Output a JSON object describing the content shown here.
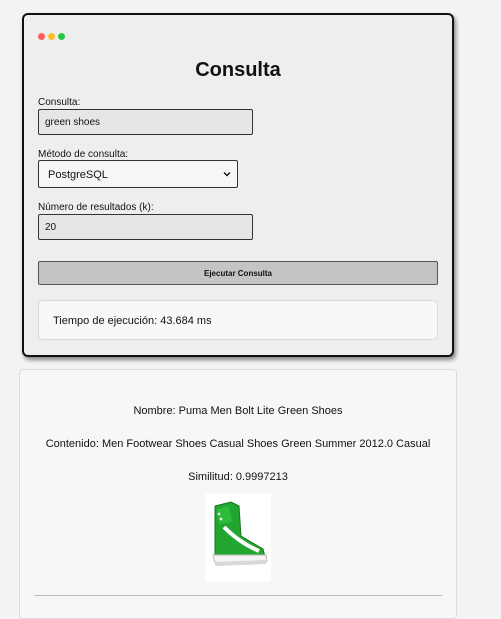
{
  "window": {
    "controls": [
      "close-dot",
      "minimize-dot",
      "maximize-dot"
    ],
    "colors": {
      "red": "#ff5f57",
      "yellow": "#ffbd2e",
      "green": "#28c940"
    }
  },
  "form": {
    "title": "Consulta",
    "query_label": "Consulta:",
    "query_value": "green shoes",
    "method_label": "Método de consulta:",
    "method_value": "PostgreSQL",
    "k_label": "Número de resultados (k):",
    "k_value": "20",
    "run_label": "Ejecutar Consulta",
    "time_text": "Tiempo de ejecución: 43.684 ms"
  },
  "results": [
    {
      "name": "Nombre: Puma Men Bolt Lite Green Shoes",
      "content": "Contenido: Men Footwear Shoes Casual Shoes Green Summer 2012.0 Casual",
      "similarity": "Similitud: 0.9997213",
      "image_icon": "green-high-top-sneaker"
    }
  ]
}
